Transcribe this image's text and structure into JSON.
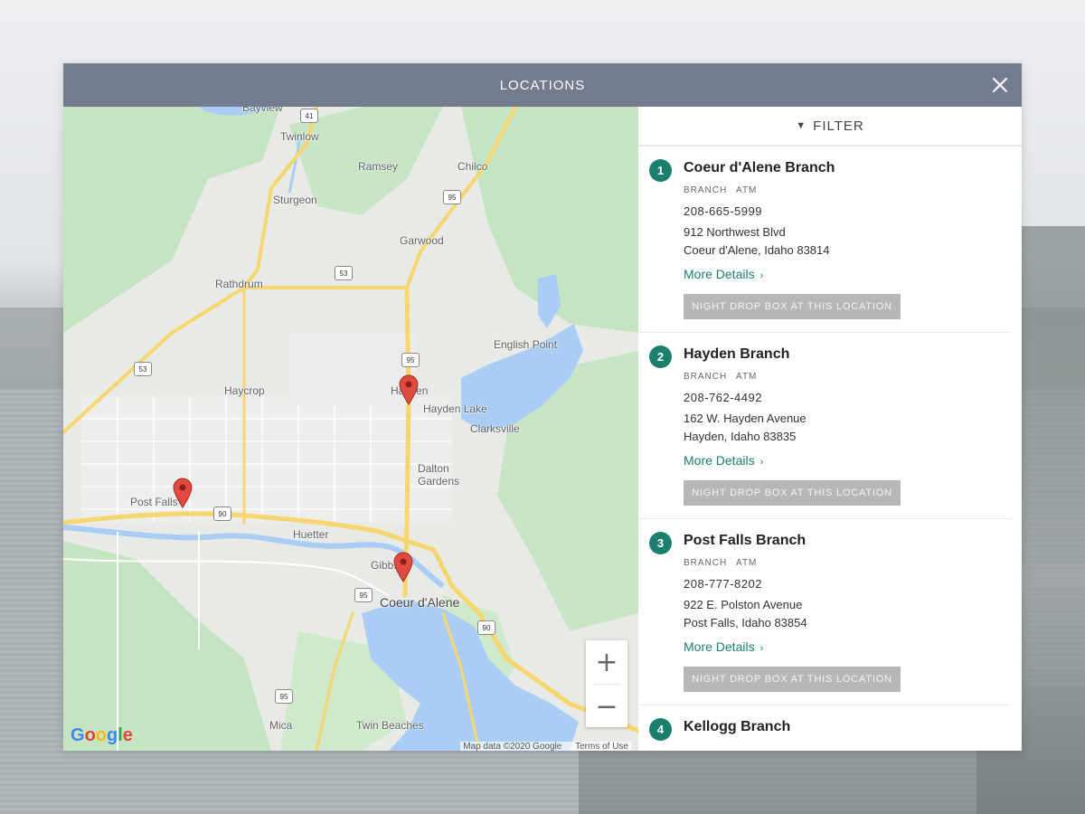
{
  "modal": {
    "title": "LOCATIONS",
    "close_icon": "close-icon"
  },
  "filter": {
    "label": "FILTER",
    "icon": "chevron-down-icon"
  },
  "map": {
    "places": {
      "bayview": "Bayview",
      "twinlow": "Twinlow",
      "ramsey": "Ramsey",
      "chilco": "Chilco",
      "sturgeon": "Sturgeon",
      "garwood": "Garwood",
      "rathdrum": "Rathdrum",
      "english_point": "English Point",
      "haycrop": "Haycrop",
      "hayden": "Hayden",
      "hayden_lake": "Hayden Lake",
      "clarksville": "Clarksville",
      "dalton_gardens": "Dalton\nGardens",
      "post_falls": "Post Falls",
      "huetter": "Huetter",
      "gibbs": "Gibbs",
      "coeur_dalene": "Coeur d'Alene",
      "mica": "Mica",
      "twin_beaches": "Twin Beaches"
    },
    "shields": {
      "s41": "41",
      "s95a": "95",
      "s53": "53",
      "s95b": "95",
      "s53b": "53",
      "s90a": "90",
      "s95c": "95",
      "s90b": "90",
      "s95d": "95"
    },
    "zoom_in": "+",
    "zoom_out": "−",
    "logo": "Google",
    "attribution": "Map data ©2020 Google",
    "terms": "Terms of Use",
    "colors": {
      "water": "#a9cdf5",
      "park": "#c5e5c2",
      "road": "#f8d66e",
      "pin": "#e04a3f"
    }
  },
  "accent_color": "#1b7f6e",
  "locations": [
    {
      "number": "1",
      "name": "Coeur d'Alene Branch",
      "tags": [
        "BRANCH",
        "ATM"
      ],
      "phone": "208-665-5999",
      "address_line1": "912 Northwest Blvd",
      "address_line2": "Coeur d'Alene, Idaho 83814",
      "details_label": "More Details",
      "night_drop_label": "NIGHT DROP BOX AT THIS LOCATION"
    },
    {
      "number": "2",
      "name": "Hayden Branch",
      "tags": [
        "BRANCH",
        "ATM"
      ],
      "phone": "208-762-4492",
      "address_line1": "162 W. Hayden Avenue",
      "address_line2": "Hayden, Idaho 83835",
      "details_label": "More Details",
      "night_drop_label": "NIGHT DROP BOX AT THIS LOCATION"
    },
    {
      "number": "3",
      "name": "Post Falls Branch",
      "tags": [
        "BRANCH",
        "ATM"
      ],
      "phone": "208-777-8202",
      "address_line1": "922 E. Polston Avenue",
      "address_line2": "Post Falls, Idaho 83854",
      "details_label": "More Details",
      "night_drop_label": "NIGHT DROP BOX AT THIS LOCATION"
    },
    {
      "number": "4",
      "name": "Kellogg Branch"
    }
  ]
}
